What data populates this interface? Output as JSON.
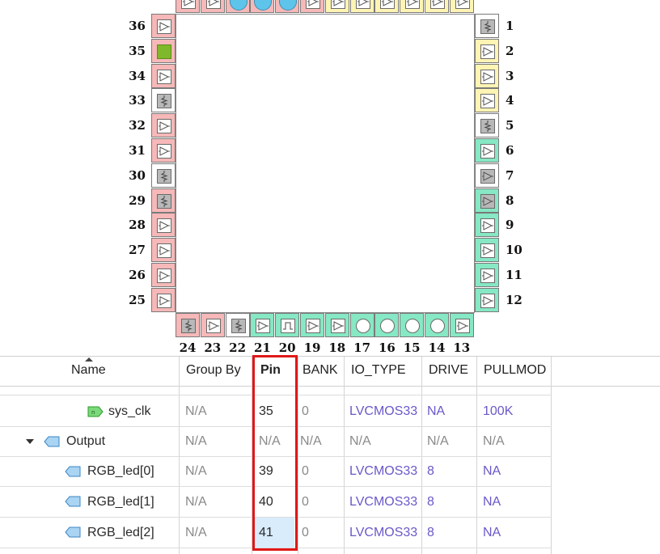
{
  "package": {
    "top_pins": [
      {
        "num": "",
        "kind": "in",
        "color": "#f6b8b8"
      },
      {
        "num": "",
        "kind": "in",
        "color": "#f6b8b8"
      },
      {
        "num": "",
        "kind": "bluecircle",
        "color": "#f6b8b8"
      },
      {
        "num": "",
        "kind": "bluecircle",
        "color": "#f6b8b8"
      },
      {
        "num": "",
        "kind": "bluecircle",
        "color": "#f6b8b8"
      },
      {
        "num": "",
        "kind": "in",
        "color": "#f6b8b8"
      },
      {
        "num": "",
        "kind": "in",
        "color": "#fff4b3"
      },
      {
        "num": "",
        "kind": "in",
        "color": "#fff4b3"
      },
      {
        "num": "",
        "kind": "in",
        "color": "#fff4b3"
      },
      {
        "num": "",
        "kind": "in",
        "color": "#fff4b3"
      },
      {
        "num": "",
        "kind": "in",
        "color": "#fff4b3"
      },
      {
        "num": "",
        "kind": "in",
        "color": "#fff4b3"
      }
    ],
    "left_pins": [
      {
        "num": "36",
        "kind": "in",
        "color": "#f6b8b8"
      },
      {
        "num": "35",
        "kind": "green",
        "color": "#f6b8b8"
      },
      {
        "num": "34",
        "kind": "in",
        "color": "#f6b8b8"
      },
      {
        "num": "33",
        "kind": "resistor",
        "color": "#ffffff"
      },
      {
        "num": "32",
        "kind": "in",
        "color": "#f6b8b8"
      },
      {
        "num": "31",
        "kind": "in",
        "color": "#f6b8b8"
      },
      {
        "num": "30",
        "kind": "resistor",
        "color": "#ffffff"
      },
      {
        "num": "29",
        "kind": "resistor",
        "color": "#f6b8b8"
      },
      {
        "num": "28",
        "kind": "in",
        "color": "#f6b8b8"
      },
      {
        "num": "27",
        "kind": "in",
        "color": "#f6b8b8"
      },
      {
        "num": "26",
        "kind": "in",
        "color": "#f6b8b8"
      },
      {
        "num": "25",
        "kind": "in",
        "color": "#f6b8b8"
      }
    ],
    "right_pins": [
      {
        "num": "1",
        "kind": "resistor",
        "color": "#ffffff"
      },
      {
        "num": "2",
        "kind": "in",
        "color": "#fff4b3"
      },
      {
        "num": "3",
        "kind": "in",
        "color": "#fff4b3"
      },
      {
        "num": "4",
        "kind": "in",
        "color": "#fff4b3"
      },
      {
        "num": "5",
        "kind": "resistor",
        "color": "#ffffff"
      },
      {
        "num": "6",
        "kind": "in",
        "color": "#86e8c4"
      },
      {
        "num": "7",
        "kind": "graytri",
        "color": "#ffffff"
      },
      {
        "num": "8",
        "kind": "graytri",
        "color": "#86e8c4"
      },
      {
        "num": "9",
        "kind": "in",
        "color": "#86e8c4"
      },
      {
        "num": "10",
        "kind": "in",
        "color": "#86e8c4"
      },
      {
        "num": "11",
        "kind": "in",
        "color": "#86e8c4"
      },
      {
        "num": "12",
        "kind": "in",
        "color": "#86e8c4"
      }
    ],
    "bottom_pins": [
      {
        "num": "24",
        "kind": "resistor",
        "color": "#f6b8b8"
      },
      {
        "num": "23",
        "kind": "in",
        "color": "#f6b8b8"
      },
      {
        "num": "22",
        "kind": "resistor",
        "color": "#ffffff"
      },
      {
        "num": "21",
        "kind": "in",
        "color": "#86e8c4"
      },
      {
        "num": "20",
        "kind": "square",
        "color": "#86e8c4"
      },
      {
        "num": "19",
        "kind": "in",
        "color": "#86e8c4"
      },
      {
        "num": "18",
        "kind": "in",
        "color": "#86e8c4"
      },
      {
        "num": "17",
        "kind": "circle",
        "color": "#86e8c4"
      },
      {
        "num": "16",
        "kind": "circle",
        "color": "#86e8c4"
      },
      {
        "num": "15",
        "kind": "circle",
        "color": "#86e8c4"
      },
      {
        "num": "14",
        "kind": "circle",
        "color": "#86e8c4"
      },
      {
        "num": "13",
        "kind": "in",
        "color": "#86e8c4"
      }
    ]
  },
  "table": {
    "headers": {
      "name": "Name",
      "group_by": "Group By",
      "pin": "Pin",
      "bank": "BANK",
      "io_type": "IO_TYPE",
      "drive": "DRIVE",
      "pullmode": "PULLMOD"
    },
    "rows": [
      {
        "name": "sys_clk",
        "group_by": "N/A",
        "pin": "35",
        "bank": "0",
        "io_type": "LVCMOS33",
        "drive": "NA",
        "pullmode": "100K"
      },
      {
        "name": "Output",
        "group_by": "N/A",
        "pin": "N/A",
        "bank": "N/A",
        "io_type": "N/A",
        "drive": "N/A",
        "pullmode": "N/A"
      },
      {
        "name": "RGB_led[0]",
        "group_by": "N/A",
        "pin": "39",
        "bank": "0",
        "io_type": "LVCMOS33",
        "drive": "8",
        "pullmode": "NA"
      },
      {
        "name": "RGB_led[1]",
        "group_by": "N/A",
        "pin": "40",
        "bank": "0",
        "io_type": "LVCMOS33",
        "drive": "8",
        "pullmode": "NA"
      },
      {
        "name": "RGB_led[2]",
        "group_by": "N/A",
        "pin": "41",
        "bank": "0",
        "io_type": "LVCMOS33",
        "drive": "8",
        "pullmode": "NA"
      }
    ]
  }
}
